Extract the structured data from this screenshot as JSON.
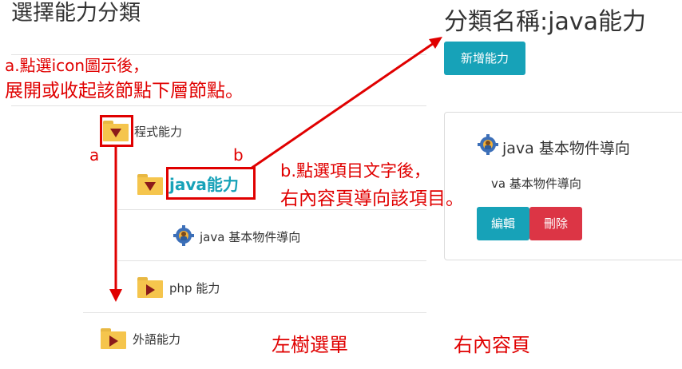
{
  "tree": {
    "title": "選擇能力分類",
    "nodes": [
      {
        "label": "程式能力"
      },
      {
        "label": "java能力"
      },
      {
        "label": "java 基本物件導向"
      },
      {
        "label": "php 能力"
      },
      {
        "label": "外語能力"
      }
    ]
  },
  "content": {
    "title": "分類名稱:java能力",
    "add_button": "新增能力",
    "card": {
      "item_title": "java 基本物件導向",
      "item_text": "va 基本物件導向",
      "edit_button": "編輯",
      "delete_button": "刪除"
    }
  },
  "annotations": {
    "note_a_line1": "a.點選icon圖示後，",
    "note_a_line2": "展開或收起該節點下層節點。",
    "note_b_line1": "b.點選項目文字後，",
    "note_b_line2": "右內容頁導向該項目。",
    "marker_a": "a",
    "marker_b": "b",
    "left_caption": "左樹選單",
    "right_caption": "右內容頁"
  },
  "colors": {
    "annotation_red": "#e00000",
    "folder_yellow": "#f5c54d",
    "triangle": "#8b1a1a",
    "link": "#17a2b8",
    "danger": "#dc3545"
  },
  "icons": [
    "folder-expanded-icon",
    "folder-collapsed-icon",
    "gear-person-icon"
  ]
}
